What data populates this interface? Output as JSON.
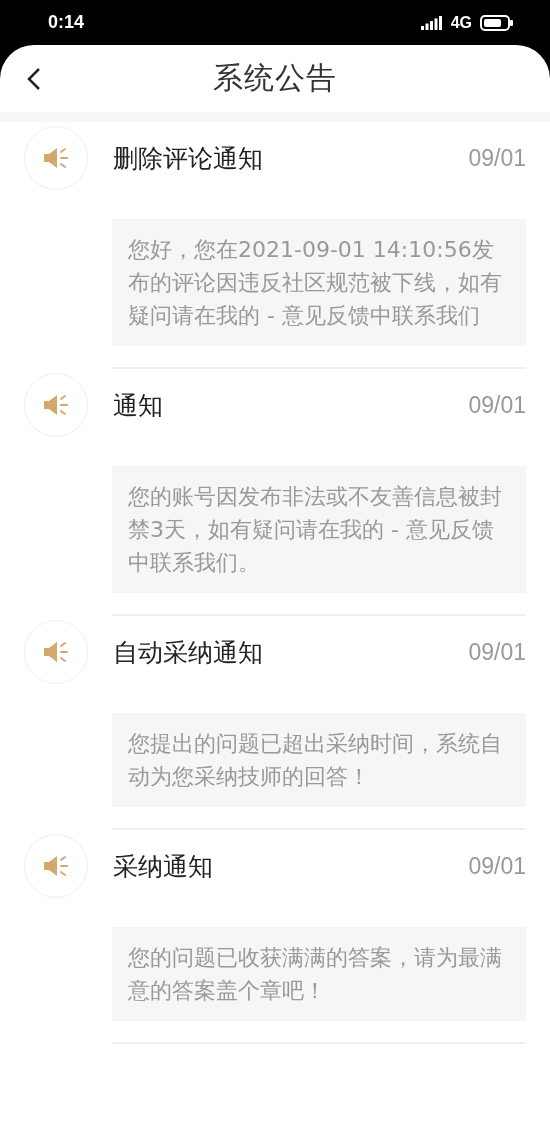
{
  "status_bar": {
    "time": "0:14",
    "network": "4G"
  },
  "header": {
    "title": "系统公告"
  },
  "notices": [
    {
      "title": "删除评论通知",
      "date": "09/01",
      "body": "您好，您在2021-09-01 14:10:56发布的评论因违反社区规范被下线，如有疑问请在我的 - 意见反馈中联系我们"
    },
    {
      "title": "通知",
      "date": "09/01",
      "body": "您的账号因发布非法或不友善信息被封禁3天，如有疑问请在我的 - 意见反馈中联系我们。"
    },
    {
      "title": "自动采纳通知",
      "date": "09/01",
      "body": "您提出的问题已超出采纳时间，系统自动为您采纳技师的回答！"
    },
    {
      "title": "采纳通知",
      "date": "09/01",
      "body": "您的问题已收获满满的答案，请为最满意的答案盖个章吧！"
    }
  ]
}
